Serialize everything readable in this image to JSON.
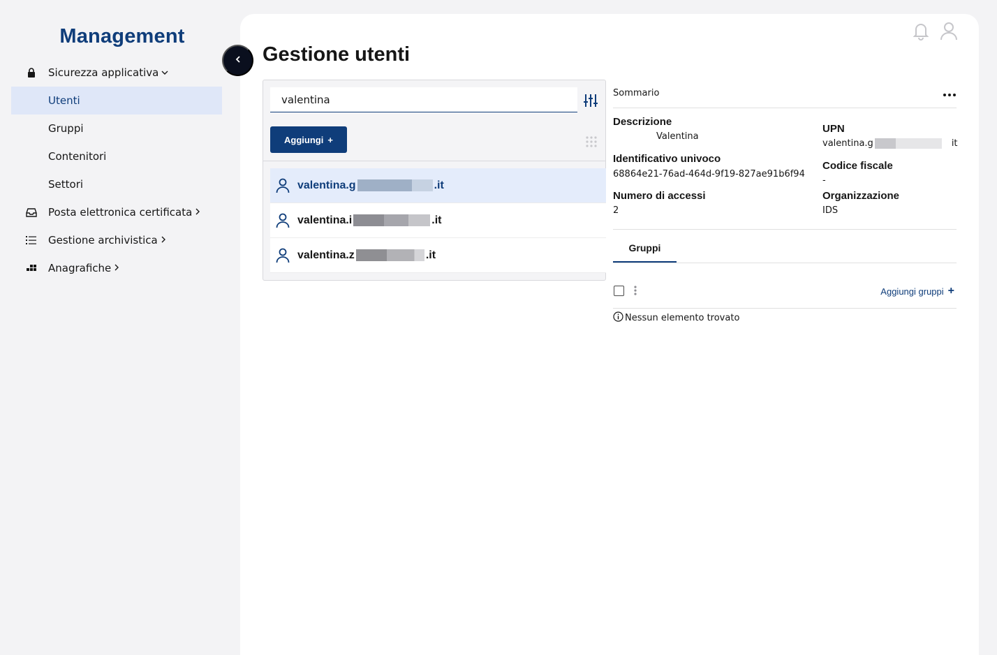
{
  "sidebar": {
    "brand": "Management",
    "items": [
      {
        "label": "Sicurezza applicativa",
        "chevron": "⌄",
        "icon": "lock-icon"
      },
      {
        "label": "Utenti"
      },
      {
        "label": "Gruppi"
      },
      {
        "label": "Contenitori"
      },
      {
        "label": "Settori"
      },
      {
        "label": "Posta elettronica certificata",
        "chevron": "›",
        "icon": "inbox-icon"
      },
      {
        "label": "Gestione archivistica",
        "chevron": "›",
        "icon": "list-icon"
      },
      {
        "label": "Anagrafiche",
        "chevron": "›",
        "icon": "apps-icon"
      }
    ]
  },
  "header": {
    "title": "Gestione utenti",
    "icons": [
      "bell-icon",
      "user-icon"
    ]
  },
  "list": {
    "search_value": "valentina",
    "add_label": "Aggiungi",
    "add_symbol": "+",
    "rows": [
      {
        "prefix": "valentina.g",
        "suffix": ".it"
      },
      {
        "prefix": "valentina.i",
        "suffix": ".it"
      },
      {
        "prefix": "valentina.z",
        "suffix": ".it"
      }
    ]
  },
  "detail": {
    "summary_label": "Sommario",
    "more": "•••",
    "descrizione_label": "Descrizione",
    "descrizione_value": "Valentina",
    "upn_label": "UPN",
    "upn_prefix": "valentina.g",
    "upn_suffix": "it",
    "id_label": "Identificativo univoco",
    "id_value": "68864e21-76ad-464d-9f19-827ae91b6f94",
    "cf_label": "Codice fiscale",
    "cf_value": "-",
    "accessi_label": "Numero di accessi",
    "accessi_value": "2",
    "org_label": "Organizzazione",
    "org_value": "IDS",
    "tab_label": "Gruppi",
    "add_groups_label": "Aggiungi gruppi",
    "add_groups_symbol": "+",
    "empty_message": "Nessun elemento trovato"
  },
  "colors": {
    "brand": "#0f3d7a",
    "selected_bg": "#e4ecfb",
    "sidebar_active": "#dfe7f8"
  }
}
